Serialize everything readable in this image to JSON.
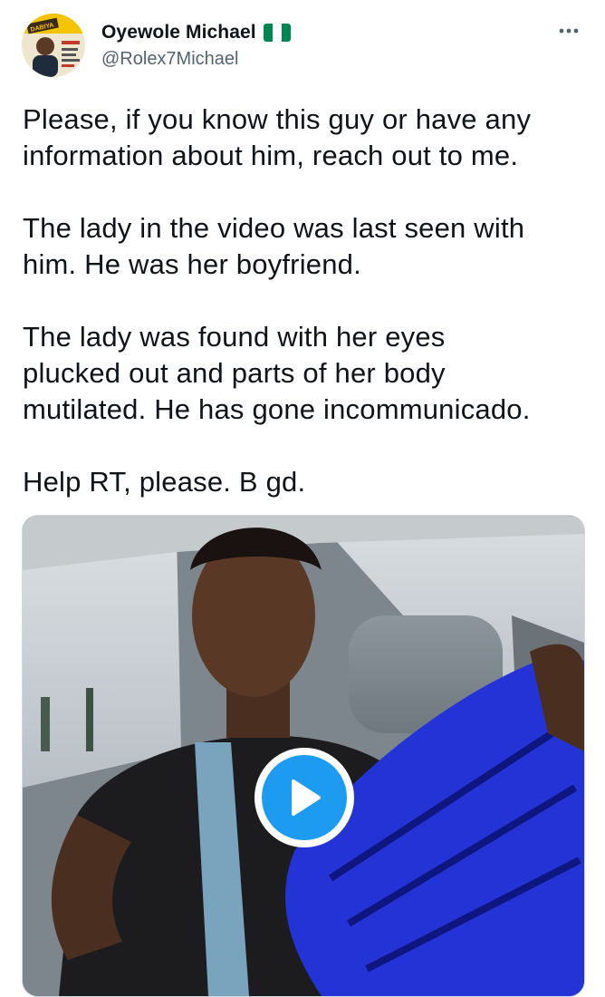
{
  "tweet": {
    "author": {
      "display_name": "Oyewole Michael",
      "handle": "@Rolex7Michael",
      "avatar_text": "DABIYA",
      "flag_colors": [
        "#008751",
        "#ffffff",
        "#008751"
      ]
    },
    "more_icon": "more-horizontal-icon",
    "paragraphs": [
      "Please, if you know this guy or have any\ninformation about him, reach out to me.",
      "The lady in the video was last seen with\nhim. He was her boyfriend.",
      "The lady was found with her eyes\nplucked out and parts of her body\nmutilated. He has gone incommunicado.",
      "Help RT, please. B gd."
    ],
    "media": {
      "type": "video",
      "play_icon": "play-icon",
      "accent": "#1d9bf0"
    }
  }
}
